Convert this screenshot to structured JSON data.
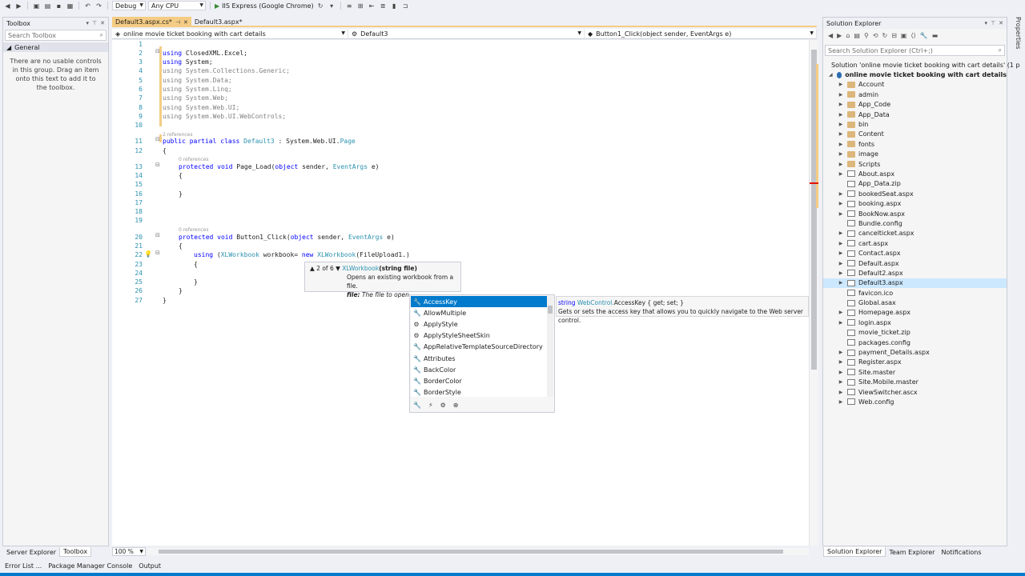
{
  "toolbar": {
    "config": "Debug",
    "platform": "Any CPU",
    "run_label": "IIS Express (Google Chrome)"
  },
  "toolbox": {
    "title": "Toolbox",
    "search_placeholder": "Search Toolbox",
    "group": "General",
    "empty_text": "There are no usable controls in this group. Drag an item onto this text to add it to the toolbox."
  },
  "tabs": [
    {
      "label": "Default3.aspx.cs*",
      "active": true
    },
    {
      "label": "Default3.aspx*",
      "active": false
    }
  ],
  "navbar": {
    "project": "online movie ticket booking with cart details",
    "class": "Default3",
    "member": "Button1_Click(object sender, EventArgs e)"
  },
  "code": {
    "ln": [
      "1",
      "2",
      "3",
      "4",
      "5",
      "6",
      "7",
      "8",
      "9",
      "10",
      "11",
      "12",
      "13",
      "14",
      "15",
      "16",
      "17",
      "18",
      "19",
      "20",
      "21",
      "22",
      "23",
      "24",
      "25",
      "26",
      "27"
    ],
    "l2": "ClosedXML.Excel;",
    "l3": "System;",
    "l4": "System.Collections.Generic;",
    "l5": "System.Data;",
    "l6": "System.Linq;",
    "l7": "System.Web;",
    "l8": "System.Web.UI;",
    "l9": "System.Web.UI.WebControls;",
    "kw_using": "using",
    "refs_class": "2 references",
    "refs0": "0 references",
    "class_decl_kw": "public partial class",
    "class_name": "Default3",
    "class_base": " : System.Web.UI.",
    "class_base_type": "Page",
    "protected_void": "protected void",
    "page_load": " Page_Load(",
    "object_kw": "object",
    "sender": " sender, ",
    "eventargs": "EventArgs",
    "e_close": " e)",
    "button_click": " Button1_Click(",
    "open_brace": "{",
    "close_brace": "}",
    "xl_type": "XLWorkbook",
    "workbook_var": " workbook= ",
    "new_kw": "new",
    "fileupload": "(FileUpload1.)",
    "l25": "}"
  },
  "paraminfo": {
    "counter": "2 of 6",
    "sig_name": "XLWorkbook",
    "sig_param": "(string file)",
    "desc": "Opens an existing workbook from a file.",
    "param_name": "file:",
    "param_desc": " The file to open."
  },
  "completion": {
    "items": [
      "AccessKey",
      "AllowMultiple",
      "ApplyStyle",
      "ApplyStyleSheetSkin",
      "AppRelativeTemplateSourceDirectory",
      "Attributes",
      "BackColor",
      "BorderColor",
      "BorderStyle"
    ]
  },
  "quickinfo": {
    "line1_kw": "string",
    "line1_type": " WebControl.",
    "line1_rest": "AccessKey { get; set; }",
    "line2": "Gets or sets the access key that allows you to quickly navigate to the Web server control."
  },
  "solution_explorer": {
    "title": "Solution Explorer",
    "search_placeholder": "Search Solution Explorer (Ctrl+;)",
    "solution": "Solution 'online movie ticket booking with cart details' (1 p",
    "project": "online movie ticket booking with cart details",
    "items": [
      {
        "label": "Account",
        "kind": "folder",
        "exp": true
      },
      {
        "label": "admin",
        "kind": "folder",
        "exp": true
      },
      {
        "label": "App_Code",
        "kind": "folder",
        "exp": true
      },
      {
        "label": "App_Data",
        "kind": "folder",
        "exp": true
      },
      {
        "label": "bin",
        "kind": "folder",
        "exp": true
      },
      {
        "label": "Content",
        "kind": "folder",
        "exp": true
      },
      {
        "label": "fonts",
        "kind": "folder",
        "exp": true
      },
      {
        "label": "image",
        "kind": "folder",
        "exp": true
      },
      {
        "label": "Scripts",
        "kind": "folder",
        "exp": true
      },
      {
        "label": "About.aspx",
        "kind": "file",
        "exp": true
      },
      {
        "label": "App_Data.zip",
        "kind": "file",
        "exp": false
      },
      {
        "label": "bookedSeat.aspx",
        "kind": "file",
        "exp": true
      },
      {
        "label": "booking.aspx",
        "kind": "file",
        "exp": true
      },
      {
        "label": "BookNow.aspx",
        "kind": "file",
        "exp": true
      },
      {
        "label": "Bundle.config",
        "kind": "file",
        "exp": false
      },
      {
        "label": "cancelticket.aspx",
        "kind": "file",
        "exp": true
      },
      {
        "label": "cart.aspx",
        "kind": "file",
        "exp": true
      },
      {
        "label": "Contact.aspx",
        "kind": "file",
        "exp": true
      },
      {
        "label": "Default.aspx",
        "kind": "file",
        "exp": true
      },
      {
        "label": "Default2.aspx",
        "kind": "file",
        "exp": true
      },
      {
        "label": "Default3.aspx",
        "kind": "file",
        "exp": true,
        "selected": true
      },
      {
        "label": "favicon.ico",
        "kind": "file",
        "exp": false
      },
      {
        "label": "Global.asax",
        "kind": "file",
        "exp": false
      },
      {
        "label": "Homepage.aspx",
        "kind": "file",
        "exp": true
      },
      {
        "label": "login.aspx",
        "kind": "file",
        "exp": true
      },
      {
        "label": "movie_ticket.zip",
        "kind": "file",
        "exp": false
      },
      {
        "label": "packages.config",
        "kind": "file",
        "exp": false
      },
      {
        "label": "payment_Details.aspx",
        "kind": "file",
        "exp": true
      },
      {
        "label": "Register.aspx",
        "kind": "file",
        "exp": true
      },
      {
        "label": "Site.master",
        "kind": "file",
        "exp": true
      },
      {
        "label": "Site.Mobile.master",
        "kind": "file",
        "exp": true
      },
      {
        "label": "ViewSwitcher.ascx",
        "kind": "file",
        "exp": true
      },
      {
        "label": "Web.config",
        "kind": "file",
        "exp": true
      }
    ]
  },
  "side_tab": "Properties",
  "bottom_left_tabs": [
    "Server Explorer",
    "Toolbox"
  ],
  "bottom_right_tabs": [
    "Solution Explorer",
    "Team Explorer",
    "Notifications"
  ],
  "bottom_output_tabs": [
    "Error List ...",
    "Package Manager Console",
    "Output"
  ],
  "zoom": "100 %"
}
